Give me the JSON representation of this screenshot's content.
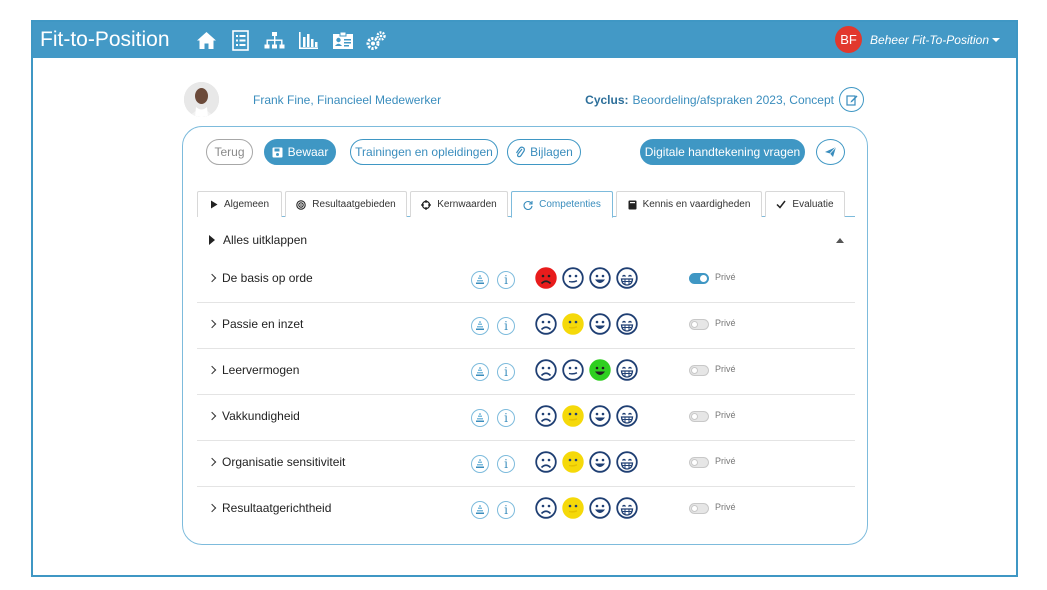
{
  "app": {
    "title": "Fit-to-Position"
  },
  "nav": {
    "icons": [
      "home-icon",
      "list-icon",
      "org-chart-icon",
      "bar-chart-icon",
      "id-card-icon",
      "settings-icon"
    ]
  },
  "user": {
    "initials": "BF",
    "menu_label": "Beheer Fit-To-Position"
  },
  "person": {
    "name": "Frank Fine, Financieel Medewerker"
  },
  "cycle": {
    "label": "Cyclus:",
    "value": "Beoordeling/afspraken 2023, Concept"
  },
  "buttons": {
    "back": "Terug",
    "save": "Bewaar",
    "trainings": "Trainingen en opleidingen",
    "attachments": "Bijlagen",
    "signature": "Digitale handtekening vragen"
  },
  "tabs": [
    {
      "label": "Algemeen",
      "icon": "play-icon",
      "active": false
    },
    {
      "label": "Resultaatgebieden",
      "icon": "target-icon",
      "active": false
    },
    {
      "label": "Kernwaarden",
      "icon": "crosshair-icon",
      "active": false
    },
    {
      "label": "Competenties",
      "icon": "refresh-icon",
      "active": true
    },
    {
      "label": "Kennis en vaardigheden",
      "icon": "book-icon",
      "active": false
    },
    {
      "label": "Evaluatie",
      "icon": "check-icon",
      "active": false
    }
  ],
  "expand_all": "Alles uitklappen",
  "private_label": "Privé",
  "colors": {
    "primary": "#4399c6",
    "dark_blue": "#1f3f73",
    "red": "#e81c1c",
    "yellow": "#f5d90a",
    "green": "#2fcf21"
  },
  "competencies": [
    {
      "label": "De basis op orde",
      "selected": 0,
      "private": true
    },
    {
      "label": "Passie en inzet",
      "selected": 1,
      "private": false
    },
    {
      "label": "Leervermogen",
      "selected": 2,
      "private": false
    },
    {
      "label": "Vakkundigheid",
      "selected": 1,
      "private": false
    },
    {
      "label": "Organisatie sensitiviteit",
      "selected": 1,
      "private": false
    },
    {
      "label": "Resultaatgerichtheid",
      "selected": 1,
      "private": false
    }
  ]
}
